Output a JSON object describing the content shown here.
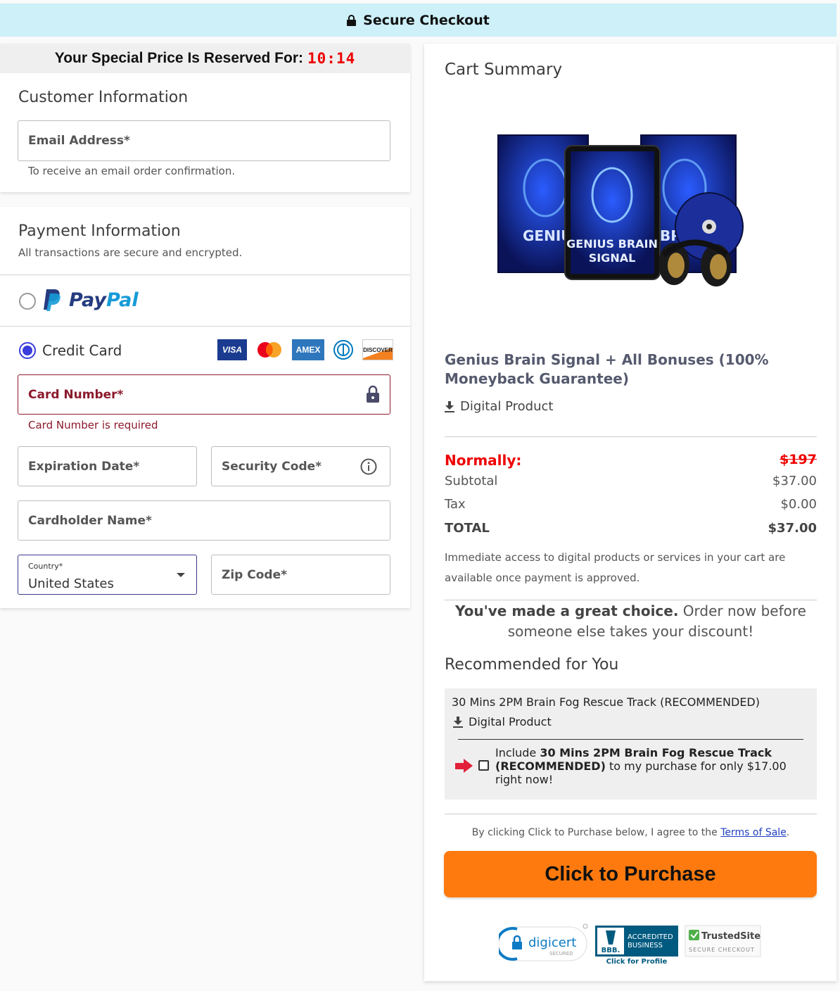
{
  "topbar": {
    "title": "Secure Checkout"
  },
  "timer": {
    "label": "Your Special Price Is Reserved For:",
    "time": "10:14"
  },
  "customer": {
    "title": "Customer Information",
    "email_label": "Email Address*",
    "email_hint": "To receive an email order confirmation."
  },
  "payment": {
    "title": "Payment Information",
    "subtitle": "All transactions are secure and encrypted.",
    "paypal_part1": "Pay",
    "paypal_part2": "Pal",
    "credit_card_label": "Credit Card",
    "card_icons": [
      "VISA",
      "mastercard",
      "AMEX",
      "diners",
      "DISCOVER"
    ],
    "card_number_label": "Card Number*",
    "card_number_error": "Card Number is required",
    "expiration_label": "Expiration Date*",
    "security_label": "Security Code*",
    "cardholder_label": "Cardholder Name*",
    "country_label": "Country*",
    "country_value": "United States",
    "zip_label": "Zip Code*"
  },
  "cart": {
    "title": "Cart Summary",
    "product_image_texts": [
      "GENIUS",
      "GENIUS BRAIN",
      "SIGNAL",
      "BRA"
    ],
    "product_name": "Genius Brain Signal + All Bonuses (100% Moneyback Guarantee)",
    "product_type": "Digital Product",
    "normally_label": "Normally:",
    "normally_price": "$197",
    "subtotal_label": "Subtotal",
    "subtotal_value": "$37.00",
    "tax_label": "Tax",
    "tax_value": "$0.00",
    "total_label": "TOTAL",
    "total_value": "$37.00",
    "access_note": "Immediate access to digital products or services in your cart are available once payment is approved.",
    "choice_bold": "You've made a great choice.",
    "choice_rest": " Order now before someone else takes your discount!",
    "recommended_title": "Recommended for You",
    "rec_name": "30 Mins 2PM Brain Fog Rescue Track (RECOMMENDED)",
    "rec_type": "Digital Product",
    "rec_include": "Include ",
    "rec_bold": "30 Mins 2PM Brain Fog Rescue Track (RECOMMENDED)",
    "rec_rest": " to my purchase for only $17.00 right now!",
    "agree_text": "By clicking Click to Purchase below, I agree to the ",
    "agree_link": "Terms of Sale",
    "agree_end": ".",
    "buy_label": "Click to Purchase"
  },
  "badges": {
    "digicert": "digicert",
    "digicert_sub": "SECURED",
    "bbb_line1": "ACCREDITED",
    "bbb_line2": "BUSINESS",
    "bbb_logo": "BBB.",
    "bbb_cta": "Click for Profile",
    "trusted": "TrustedSite",
    "trusted_sub": "SECURE CHECKOUT"
  },
  "colors": {
    "accent": "#3b3ddd",
    "error": "#8b1a2c",
    "buy": "#ff7a0e",
    "topbar": "#cdf0f9",
    "price_red": "#e00000"
  }
}
